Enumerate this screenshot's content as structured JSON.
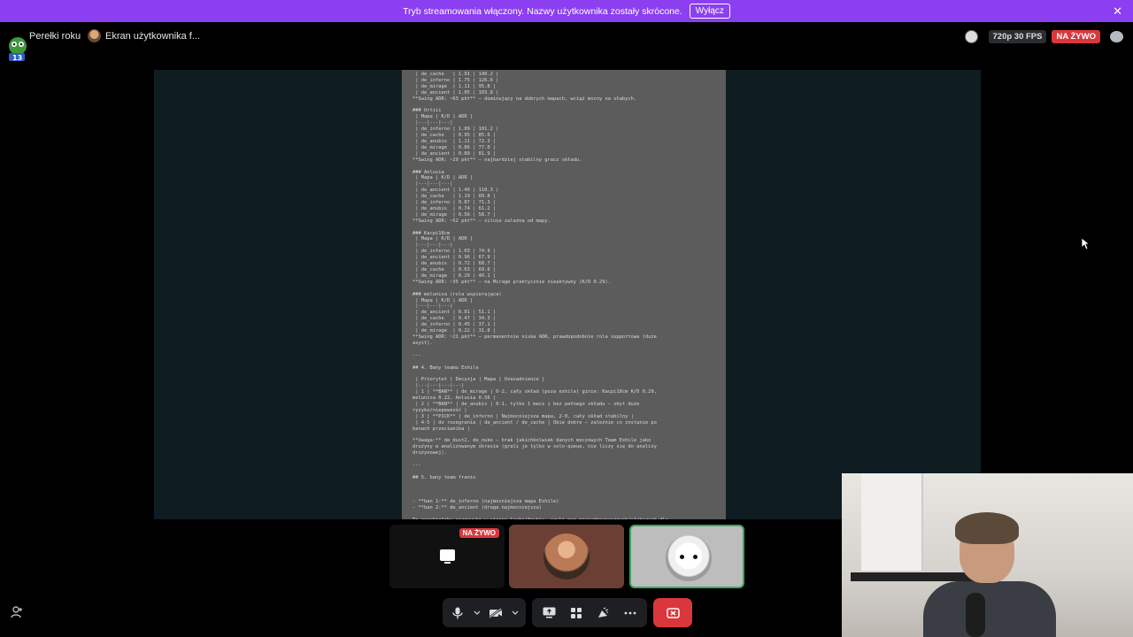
{
  "banner": {
    "message": "Tryb streamowania włączony. Nazwy użytkownika zostały skrócone.",
    "button": "Wyłącz",
    "close": "✕"
  },
  "header": {
    "channel": "Perełki roku",
    "crumb_sep": "•",
    "stream_title": "Ekran użytkownika f...",
    "quality": "720p 30 FPS",
    "live": "NA ŻYWO"
  },
  "document": {
    "lines": [
      " | de_cache   | 1.91 | 140.2 |",
      " | de_inferno | 1.75 | 126.6 |",
      " | de_mirage  | 1.11 | 95.8 |",
      " | de_ancient | 1.05 | 103.8 |",
      "**Swing ADR: ~63 pkt** – dominujący na dobrych mapach, wciąż mocny na słabych.",
      "",
      "### Ortiii",
      " | Mapa | K/D | ADR |",
      " |---|---|---|",
      " | de_inferno | 1.09 | 101.2 |",
      " | de_cache   | 0.95 | 85.6 |",
      " | de_anubis  | 1.11 | 72.3 |",
      " | de_mirage  | 0.86 | 77.0 |",
      " | de_ancient | 0.89 | 81.9 |",
      "**Swing ADR: ~29 pkt** – najbardziej stabilny gracz składu.",
      "",
      "### Anlusia",
      " | Mapa | K/D | ADR |",
      " |---|---|---|",
      " | de_ancient | 1.40 | 110.3 |",
      " | de_cache   | 1.19 | 89.8 |",
      " | de_inferno | 0.87 | 71.3 |",
      " | de_anubis  | 0.74 | 61.2 |",
      " | de_mirage  | 0.56 | 58.7 |",
      "**Swing ADR: ~52 pkt** – silnie zależna od mapy.",
      "",
      "### Kacpi18cm",
      " | Mapa | K/D | ADR |",
      " |---|---|---|",
      " | de_inferno | 1.03 | 74.9 |",
      " | de_ancient | 0.96 | 67.9 |",
      " | de_anubis  | 0.72 | 68.7 |",
      " | de_cache   | 0.63 | 69.6 |",
      " | de_mirage  | 0.29 | 40.1 |",
      "**Swing ADR: ~35 pkt** – na Mirage praktycznie nieaktywny (K/D 0.29).",
      "",
      "### melunisa (rola wspierająca)",
      " | Mapa | K/D | ADR |",
      " |---|---|---|",
      " | de_ancient | 0.81 | 51.1 |",
      " | de_cache   | 0.47 | 34.3 |",
      " | de_inferno | 0.45 | 37.1 |",
      " | de_mirage  | 0.22 | 31.8 |",
      "**Swing ADR: ~21 pkt** – permanentnie niska ADR, prawdopodobnie rola supportowa (duże",
      "asyst).",
      "",
      "---",
      "",
      "## 4. Bany teamu Exhile",
      "",
      " | Priorytet | Decyzja | Mapa | Uzasadnienie |",
      " |---|---|---|---|",
      " | 1 | **BAN** | de_mirage | 0-2, cały skład (poza exhile) ginie: Kacpi18cm K/D 0.29,",
      "melunisa 0.22, Anlusia 0.56 |",
      " | 2 | **BAN** | de_anubis | 0-1, tylko 1 mecz i bez pełnego składu – zbyt duże",
      "ryzyko/niepewność |",
      " | 3 | **PICK** | de_inferno | Najmocniejsza mapa, 2-0, cały skład stabilny |",
      " | 4-5 | do rozegrania | de_ancient / de_cache | Obie dobre – zależnie co zostanie po",
      "banach przeciwnika |",
      "",
      "**Uwaga:** de_dust2, de_nuke – brak jakichkolwiek danych meczowych Team Exhile jako",
      "drużyny w analizowanym okresie (grali je tylko w solo-queue, nie liczy się do analizy",
      "drużynowej).",
      "",
      "---",
      "",
      "## 5. bany team franio",
      "",
      "",
      "",
      "- **ban 1:** de_inferno (najmocniejsza mapa Exhile)",
      "- **ban 2:** de_ancient (druga najmocniejsza)",
      "",
      "To zepchnęłoby rozgrywkę w stronę Cache/Anubis, czyli map niejednoznacznych/słabszych dla"
    ]
  },
  "tiles": {
    "screen_live": "NA ŻYWO"
  },
  "icons": {
    "invite": "add-user-icon",
    "mic": "microphone-icon",
    "camera": "camera-off-icon",
    "share": "screen-share-icon",
    "activities": "activities-icon",
    "soundboard": "soundboard-icon",
    "more": "more-icon",
    "hangup": "hangup-icon"
  },
  "colors": {
    "banner": "#8b3ff0",
    "live": "#da373c",
    "hangup": "#da373c",
    "speaking": "#3ba55c"
  }
}
